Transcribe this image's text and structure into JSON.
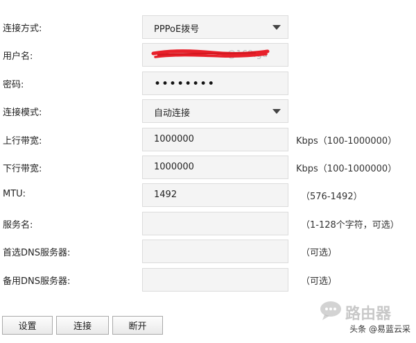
{
  "form": {
    "connection_type": {
      "label": "连接方式:",
      "value": "PPPoE拨号"
    },
    "username": {
      "label": "用户名:",
      "value": "@169.gd"
    },
    "password": {
      "label": "密码:",
      "value": "••••••••"
    },
    "connection_mode": {
      "label": "连接模式:",
      "value": "自动连接"
    },
    "upload_bandwidth": {
      "label": "上行带宽:",
      "value": "1000000",
      "hint": "Kbps（100-1000000）"
    },
    "download_bandwidth": {
      "label": "下行带宽:",
      "value": "1000000",
      "hint": "Kbps（100-1000000）"
    },
    "mtu": {
      "label": "MTU:",
      "value": "1492",
      "hint": "（576-1492）"
    },
    "service_name": {
      "label": "服务名:",
      "value": "",
      "hint": "（1-128个字符，可选）"
    },
    "primary_dns": {
      "label": "首选DNS服务器:",
      "value": "",
      "hint": "（可选）"
    },
    "secondary_dns": {
      "label": "备用DNS服务器:",
      "value": "",
      "hint": "（可选）"
    }
  },
  "buttons": {
    "settings": "设置",
    "connect": "连接",
    "disconnect": "断开"
  },
  "watermark": {
    "brand": "路由器",
    "byline": "头条 @易蓝云采"
  },
  "colors": {
    "field_background": "#f4f4f4",
    "redaction": "#e8202a"
  },
  "icons": {
    "dropdown": "triangle-down",
    "watermark": "chat-bubble"
  }
}
